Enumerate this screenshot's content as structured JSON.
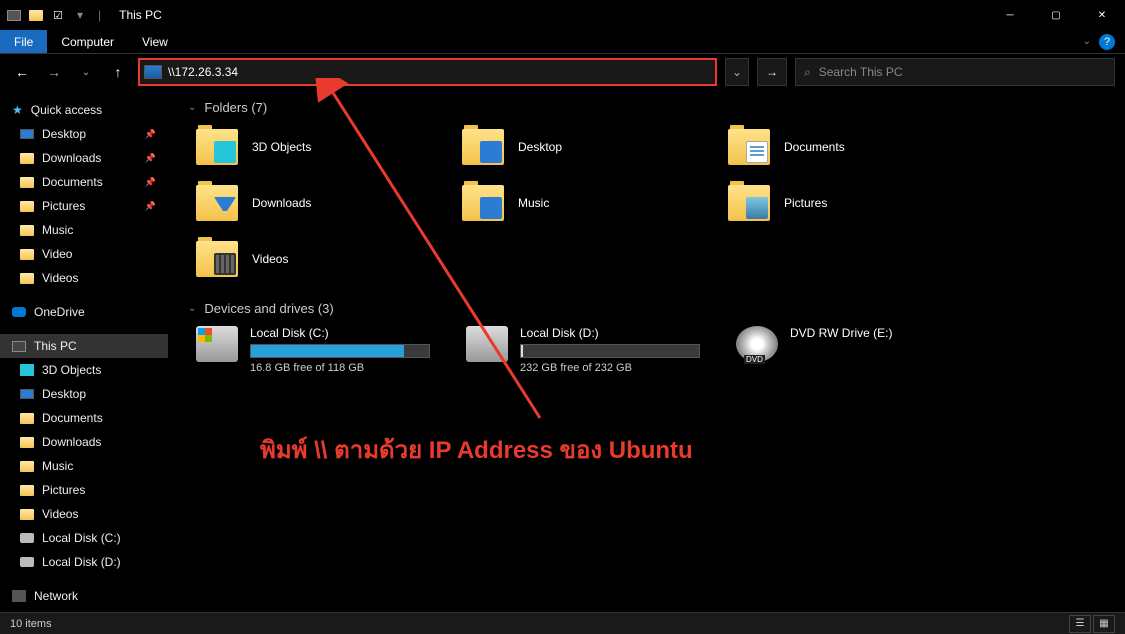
{
  "titlebar": {
    "title": "This PC"
  },
  "ribbon": {
    "file": "File",
    "computer": "Computer",
    "view": "View"
  },
  "address": {
    "value": "\\\\172.26.3.34"
  },
  "search": {
    "placeholder": "Search This PC"
  },
  "sidebar": {
    "quick_access": "Quick access",
    "desktop": "Desktop",
    "downloads": "Downloads",
    "documents": "Documents",
    "pictures": "Pictures",
    "music": "Music",
    "video": "Video",
    "videos": "Videos",
    "onedrive": "OneDrive",
    "this_pc": "This PC",
    "objects3d": "3D Objects",
    "desktop2": "Desktop",
    "documents2": "Documents",
    "downloads2": "Downloads",
    "music2": "Music",
    "pictures2": "Pictures",
    "videos2": "Videos",
    "local_c": "Local Disk (C:)",
    "local_d": "Local Disk (D:)",
    "network": "Network"
  },
  "content": {
    "folders_header": "Folders (7)",
    "drives_header": "Devices and drives (3)",
    "folders": {
      "objects3d": "3D Objects",
      "desktop": "Desktop",
      "documents": "Documents",
      "downloads": "Downloads",
      "music": "Music",
      "pictures": "Pictures",
      "videos": "Videos"
    },
    "drives": {
      "c": {
        "name": "Local Disk (C:)",
        "free": "16.8 GB free of 118 GB",
        "pct": 86
      },
      "d": {
        "name": "Local Disk (D:)",
        "free": "232 GB free of 232 GB",
        "pct": 1
      },
      "dvd": {
        "name": "DVD RW Drive (E:)"
      }
    }
  },
  "annotation": "พิมพ์ \\\\ ตามด้วย IP Address ของ Ubuntu",
  "status": {
    "items": "10 items"
  }
}
